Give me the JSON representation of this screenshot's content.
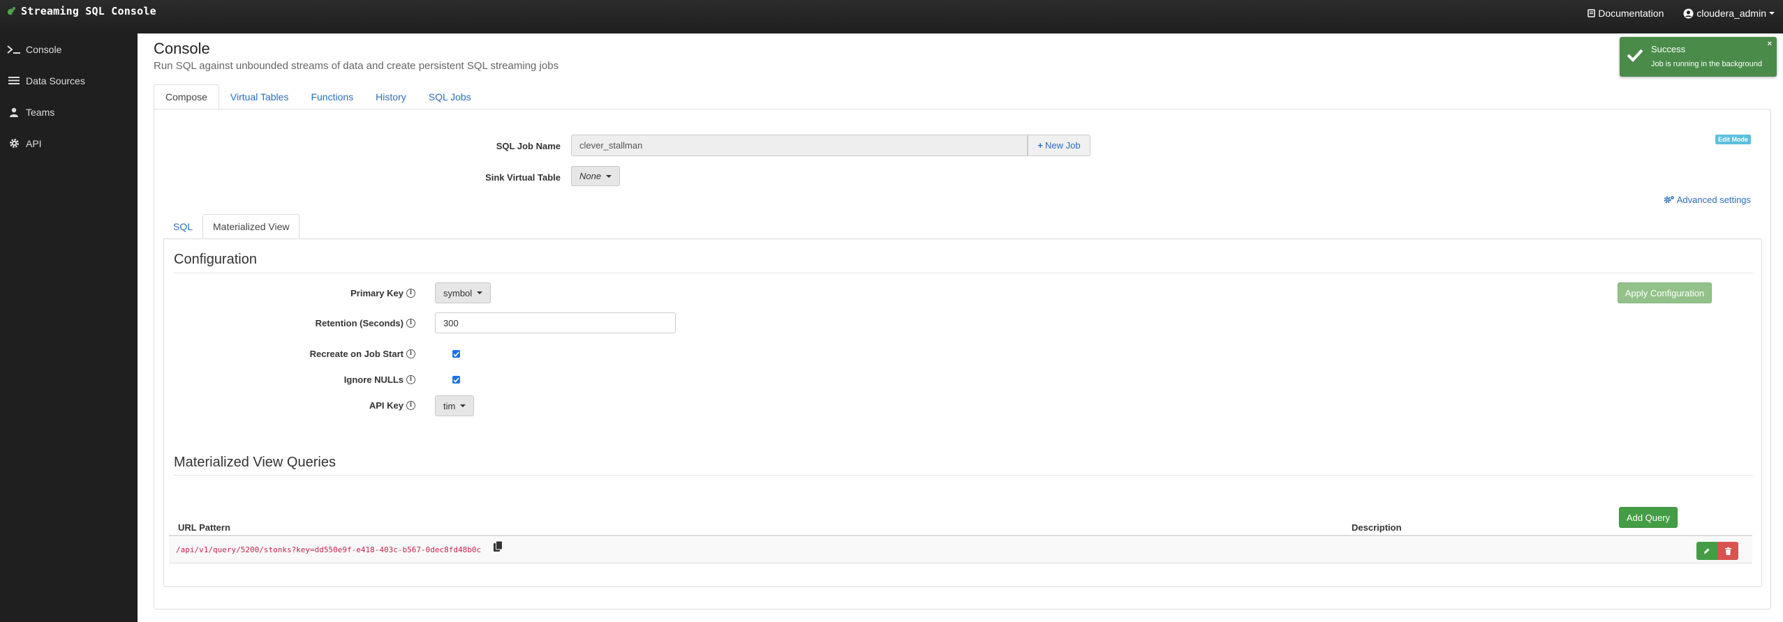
{
  "app": {
    "title": "Streaming SQL Console"
  },
  "topnav": {
    "documentation": "Documentation",
    "user": "cloudera_admin"
  },
  "sidebar": {
    "items": [
      {
        "label": "Console",
        "icon": "terminal-icon"
      },
      {
        "label": "Data Sources",
        "icon": "list-icon"
      },
      {
        "label": "Teams",
        "icon": "user-icon"
      },
      {
        "label": "API",
        "icon": "gear-icon"
      }
    ]
  },
  "page": {
    "title": "Console",
    "subtitle": "Run SQL against unbounded streams of data and create persistent SQL streaming jobs"
  },
  "tabs": [
    "Compose",
    "Virtual Tables",
    "Functions",
    "History",
    "SQL Jobs"
  ],
  "compose": {
    "edit_mode": "Edit Mode",
    "job_name_label": "SQL Job Name",
    "job_name_value": "clever_stallman",
    "new_job": "New Job",
    "sink_label": "Sink Virtual Table",
    "sink_value": "None",
    "advanced_settings": "Advanced settings"
  },
  "subtabs": [
    "SQL",
    "Materialized View"
  ],
  "configuration": {
    "title": "Configuration",
    "primary_key_label": "Primary Key",
    "primary_key_value": "symbol",
    "retention_label": "Retention (Seconds)",
    "retention_value": "300",
    "recreate_label": "Recreate on Job Start",
    "recreate_checked": true,
    "ignore_nulls_label": "Ignore NULLs",
    "ignore_nulls_checked": true,
    "api_key_label": "API Key",
    "api_key_value": "tim",
    "apply_button": "Apply Configuration"
  },
  "queries": {
    "title": "Materialized View Queries",
    "add_button": "Add Query",
    "columns": [
      "URL Pattern",
      "Description"
    ],
    "rows": [
      {
        "url": "/api/v1/query/5200/stonks?key=dd550e9f-e418-403c-b567-0dec8fd48b0c",
        "description": ""
      }
    ]
  },
  "toast": {
    "title": "Success",
    "message": "Job is running in the background",
    "close": "×"
  },
  "colors": {
    "success": "#449d44",
    "danger": "#d9534f",
    "link": "#2a6ebb",
    "sidebar": "#1f1f1f"
  }
}
